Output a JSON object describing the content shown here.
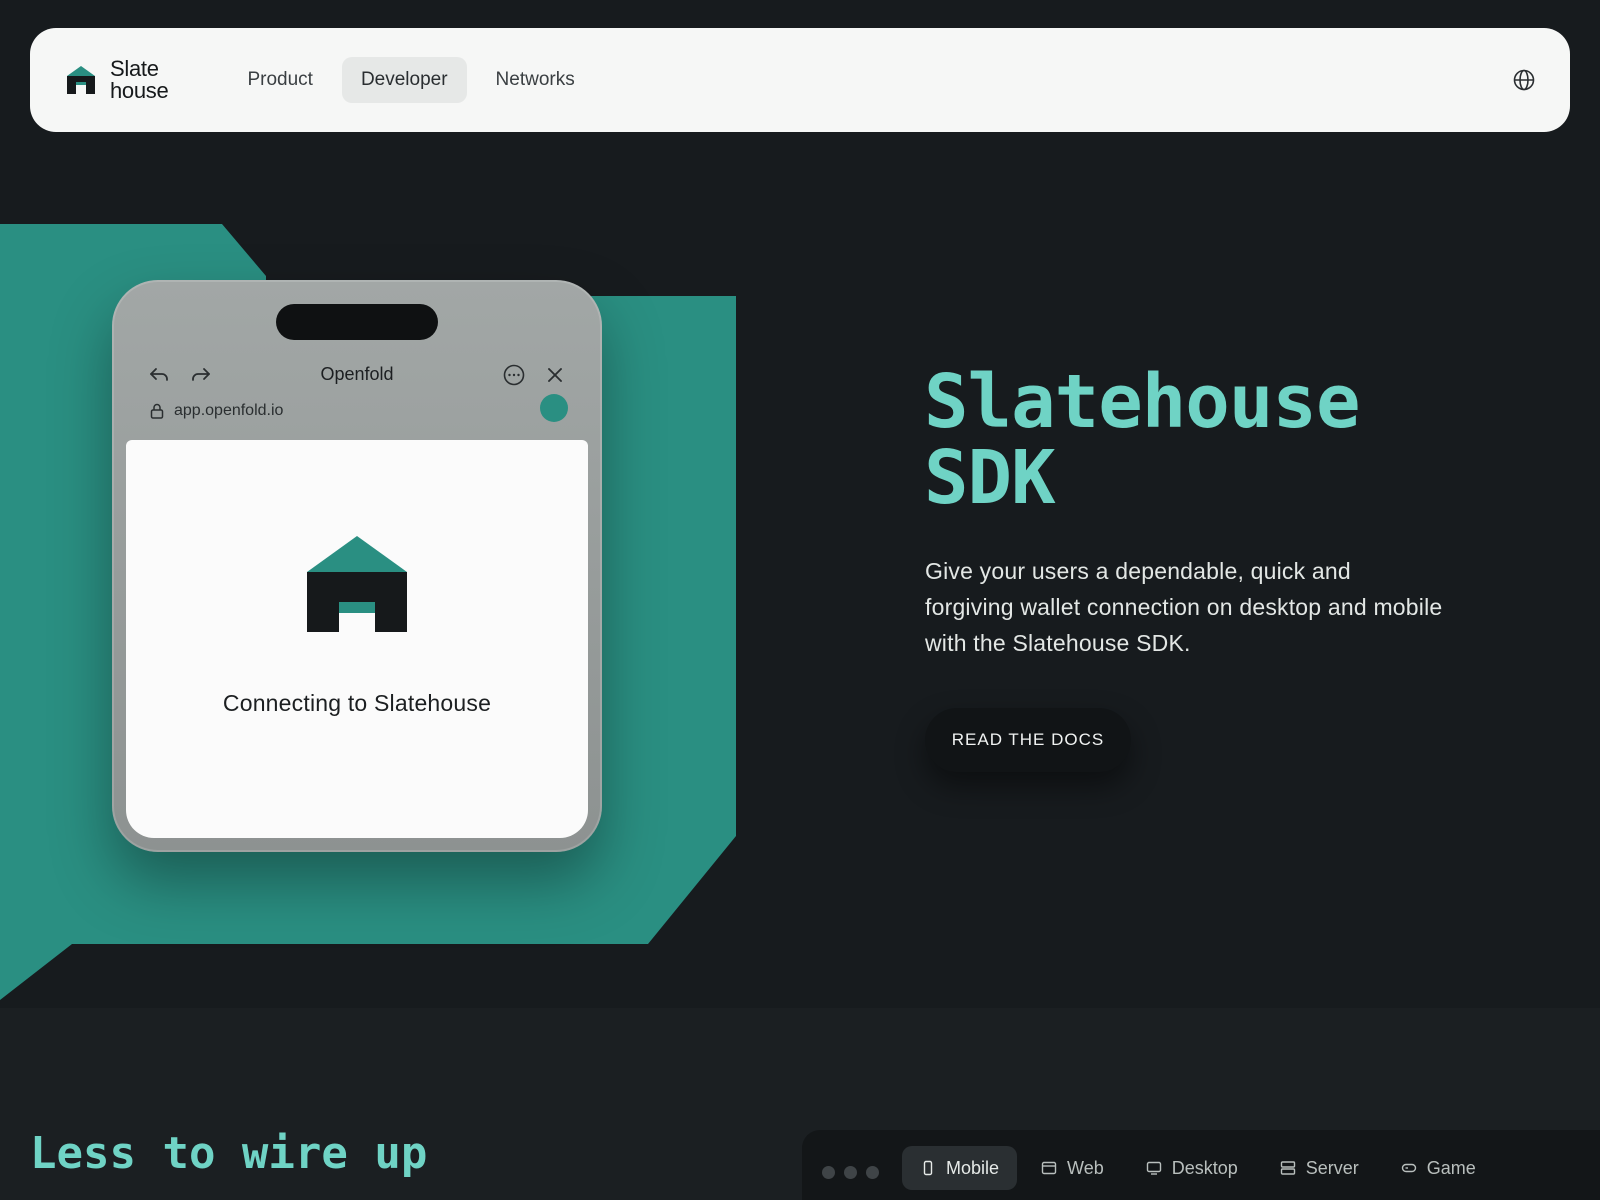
{
  "brand": {
    "name_line1": "Slate",
    "name_line2": "house",
    "accent": "#2a8f82",
    "accent_light": "#6fd3c5"
  },
  "nav": {
    "links": [
      {
        "label": "Product",
        "active": false
      },
      {
        "label": "Developer",
        "active": true
      },
      {
        "label": "Networks",
        "active": false
      }
    ],
    "language_icon": "globe-icon"
  },
  "phone": {
    "title": "Openfold",
    "url": "app.openfold.io",
    "status": "Connecting to Slatehouse"
  },
  "hero": {
    "title_line1": "Slatehouse",
    "title_line2": "SDK",
    "description": "Give your users a dependable, quick and forgiving wallet connection on desktop and mobile with the Slatehouse SDK.",
    "cta": "READ THE DOCS"
  },
  "lower": {
    "title": "Less to wire up",
    "platform_tabs": [
      {
        "label": "Mobile",
        "icon": "mobile-icon",
        "active": true
      },
      {
        "label": "Web",
        "icon": "browser-window-icon",
        "active": false
      },
      {
        "label": "Desktop",
        "icon": "monitor-icon",
        "active": false
      },
      {
        "label": "Server",
        "icon": "server-icon",
        "active": false
      },
      {
        "label": "Game",
        "icon": "gamepad-icon",
        "active": false
      }
    ]
  }
}
